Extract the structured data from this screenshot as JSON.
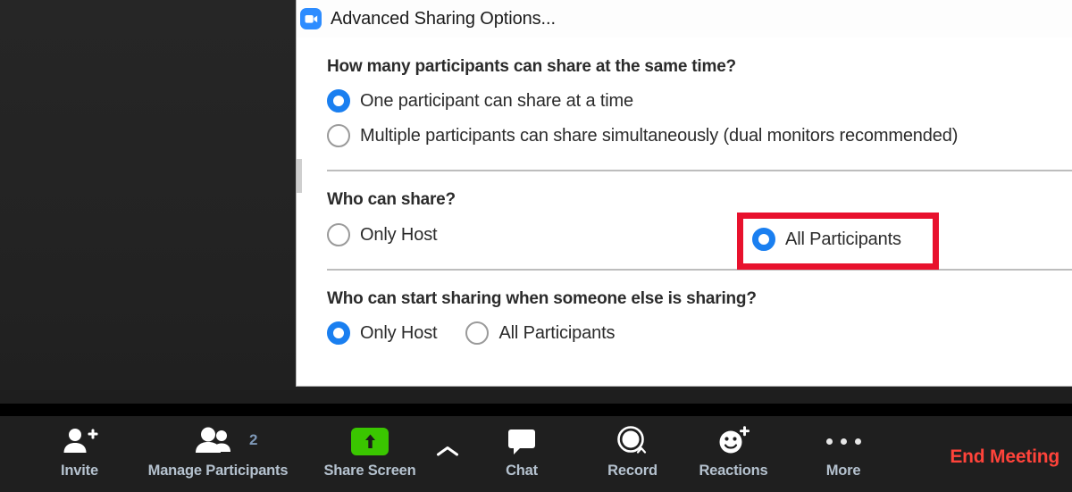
{
  "dialog": {
    "title": "Advanced Sharing Options...",
    "logo_icon": "zoom-video-logo-icon",
    "sections": [
      {
        "heading": "How many participants can share at the same time?",
        "options": [
          {
            "label": "One participant can share at a time",
            "selected": true
          },
          {
            "label": "Multiple participants can share simultaneously (dual monitors recommended)",
            "selected": false
          }
        ]
      },
      {
        "heading": "Who can share?",
        "options": [
          {
            "label": "Only Host",
            "selected": false
          },
          {
            "label": "All Participants",
            "selected": true
          }
        ]
      },
      {
        "heading": "Who can start sharing when someone else is sharing?",
        "options": [
          {
            "label": "Only Host",
            "selected": true
          },
          {
            "label": "All Participants",
            "selected": false
          }
        ]
      }
    ]
  },
  "annotation": {
    "type": "red-highlight-rectangle",
    "target": "All Participants radio option under Who can share?",
    "color": "#e8112d"
  },
  "toolbar": {
    "items": [
      {
        "label": "Invite",
        "icon": "person-add-icon"
      },
      {
        "label": "Manage Participants",
        "icon": "people-icon",
        "badge": "2"
      },
      {
        "label": "Share Screen",
        "icon": "share-screen-up-arrow-icon"
      },
      {
        "label": "Chat",
        "icon": "chat-bubble-icon"
      },
      {
        "label": "Record",
        "icon": "record-circle-icon"
      },
      {
        "label": "Reactions",
        "icon": "smiley-plus-icon"
      },
      {
        "label": "More",
        "icon": "ellipsis-icon"
      }
    ],
    "share_caret_icon": "chevron-up-icon",
    "end_meeting_label": "End Meeting"
  },
  "colors": {
    "accent_blue": "#1a7ff0",
    "zoom_logo_blue": "#2d8cff",
    "share_green": "#3ac600",
    "end_meeting_red": "#ff433a",
    "annotation_red": "#e8112d",
    "toolbar_bg": "#1f1f1f",
    "toolbar_label": "#b5c2cf"
  }
}
